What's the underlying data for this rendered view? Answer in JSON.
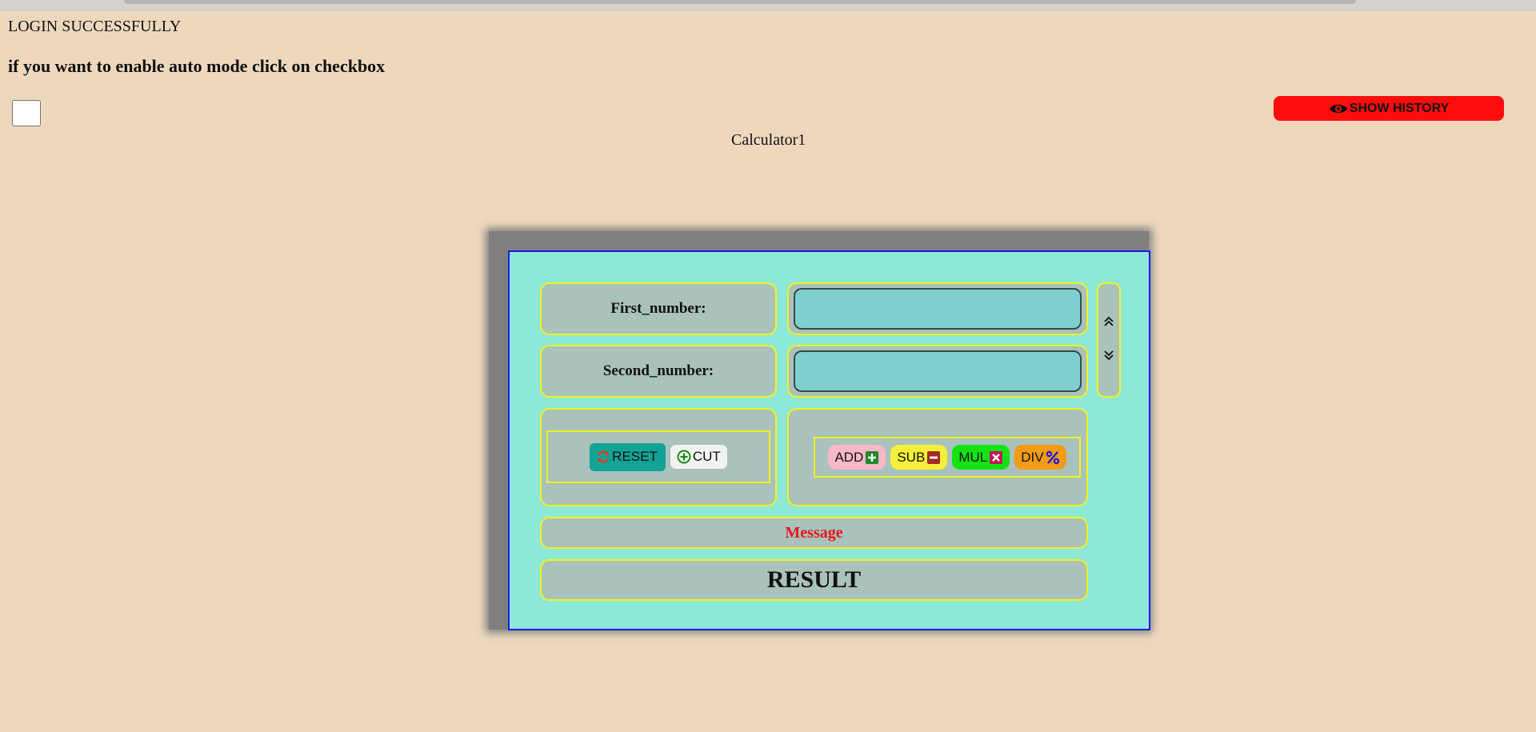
{
  "page": {
    "login_message": "LOGIN SUCCESSFULLY",
    "auto_mode_hint": "if you want to enable auto mode click on checkbox",
    "auto_mode_checked": false,
    "show_history_label": "SHOW HISTORY",
    "calculator_title": "Calculator1"
  },
  "calculator": {
    "first_label": "First_number:",
    "first_value": "",
    "second_label": "Second_number:",
    "second_value": "",
    "reset_label": "RESET",
    "cut_label": "CUT",
    "operations": [
      {
        "label": "ADD",
        "icon": "plus-square-icon"
      },
      {
        "label": "SUB",
        "icon": "minus-square-icon"
      },
      {
        "label": "MUL",
        "icon": "times-square-icon"
      },
      {
        "label": "DIV",
        "icon": "percent-icon"
      }
    ],
    "message": "Message",
    "result": "RESULT"
  },
  "colors": {
    "page_bg": "#eed8bd",
    "calculator_bg": "#8ee8d8",
    "panel_bg": "#a9c2bb",
    "panel_border": "#f2f21a",
    "history_button": "#ff0d0d",
    "message_text": "#e8141e"
  }
}
